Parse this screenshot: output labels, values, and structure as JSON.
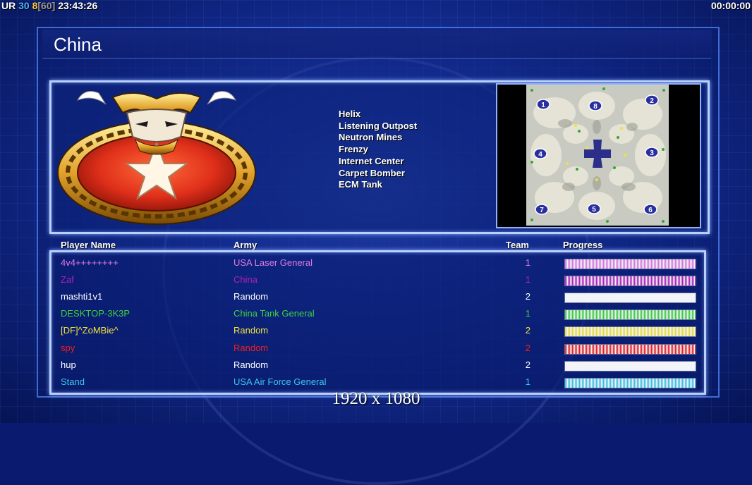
{
  "hud": {
    "ur_label": "UR",
    "ur_value": "30",
    "slot_value": "8",
    "slot_max": "[60]",
    "clock": "23:43:26",
    "timer": "00:00:00"
  },
  "faction": {
    "title": "China"
  },
  "tech_list": [
    "Helix",
    "Listening Outpost",
    "Neutron Mines",
    "Frenzy",
    "Internet Center",
    "Carpet Bomber",
    "ECM Tank"
  ],
  "minimap": {
    "start_positions": [
      "1",
      "8",
      "2",
      "4",
      "3",
      "7",
      "5",
      "6"
    ]
  },
  "table": {
    "headers": {
      "player": "Player Name",
      "army": "Army",
      "team": "Team",
      "progress": "Progress"
    },
    "players": [
      {
        "name": "4v4++++++++",
        "army": "USA Laser General",
        "team": "1",
        "color": "#e07ae0",
        "progress": 1.0
      },
      {
        "name": "Zaf",
        "army": "China",
        "team": "1",
        "color": "#b020b8",
        "progress": 1.0
      },
      {
        "name": "mashti1v1",
        "army": "Random",
        "team": "2",
        "color": "#ffffff",
        "progress": 1.0
      },
      {
        "name": "DESKTOP-3K3P",
        "army": "China Tank General",
        "team": "1",
        "color": "#3fd23f",
        "progress": 1.0
      },
      {
        "name": "[DF]^ZoMBie^",
        "army": "Random",
        "team": "2",
        "color": "#f0e23c",
        "progress": 1.0
      },
      {
        "name": "spy",
        "army": "Random",
        "team": "2",
        "color": "#f01e1e",
        "progress": 1.0
      },
      {
        "name": "hup",
        "army": "Random",
        "team": "2",
        "color": "#ffffff",
        "progress": 1.0
      },
      {
        "name": "Stand",
        "army": "USA Air Force General",
        "team": "1",
        "color": "#3cc6e8",
        "progress": 1.0
      }
    ]
  },
  "resolution_label": "1920 x 1080"
}
